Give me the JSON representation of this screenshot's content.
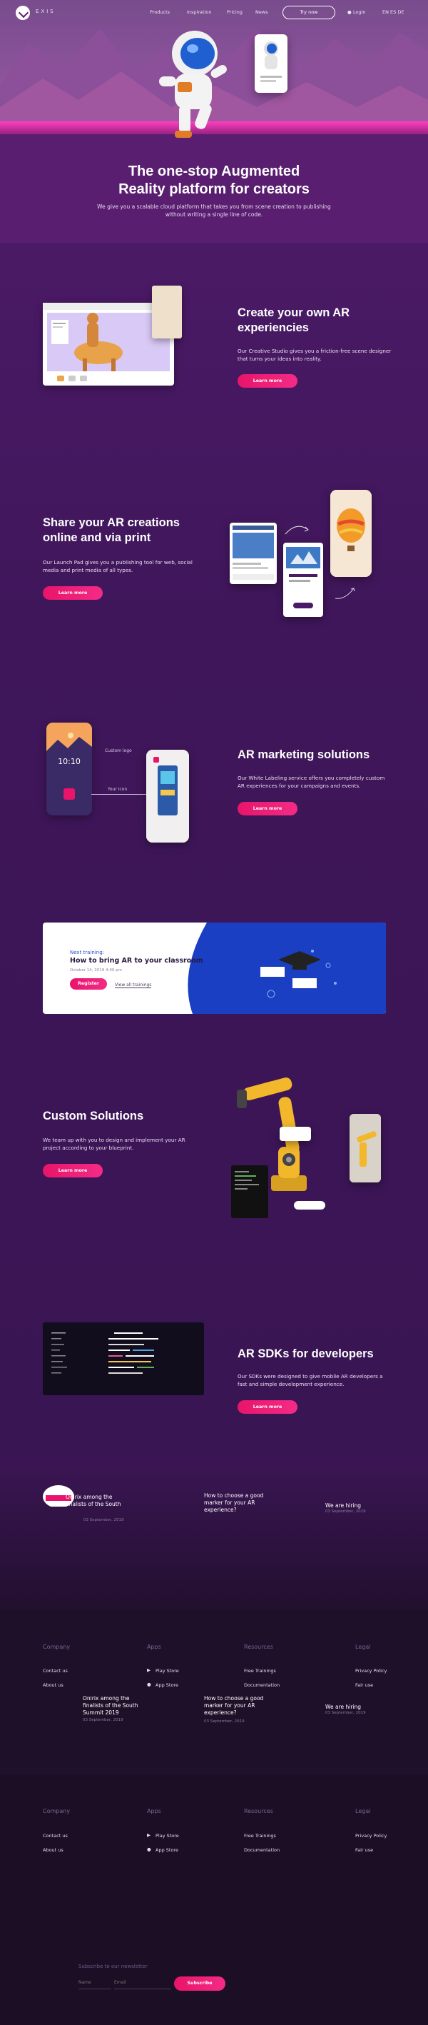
{
  "nav": {
    "logo_text": "EXIS",
    "links": [
      "Products",
      "Inspiration",
      "Pricing",
      "News"
    ],
    "try_now": "Try now",
    "login": "Login",
    "langs": "EN  ES  DE"
  },
  "hero": {
    "title_line1": "The one-stop Augmented",
    "title_line2": "Reality platform for creators",
    "subtitle_line1": "We give you a scalable cloud platform that takes you from scene creation to publishing",
    "subtitle_line2": "without writing a single line of code."
  },
  "s1": {
    "title_line1": "Create your own AR",
    "title_line2": "experiencies",
    "text_line1": "Our Creative Studio gives you a friction-free scene designer",
    "text_line2": "that turns your ideas into reality.",
    "button": "Learn more"
  },
  "s2": {
    "title_line1": "Share your AR creations",
    "title_line2": "online and via print",
    "text_line1": "Our Launch Pad gives you a publishing tool for web, social",
    "text_line2": "media and print media of all types.",
    "button": "Learn more"
  },
  "s3": {
    "title": "AR marketing solutions",
    "text_line1": "Our White Labeling service offers you completely custom",
    "text_line2": "AR experiences for your campaigns and events.",
    "button": "Learn more",
    "phone_time": "10:10",
    "label_logo": "Custom logo",
    "label_icon": "Your icon"
  },
  "training": {
    "kicker": "Next training:",
    "title": "How to bring AR to your classroom",
    "date": "October 14, 2019 4:00 pm",
    "register": "Register",
    "view_all": "View all trainings"
  },
  "s4": {
    "title": "Custom Solutions",
    "text_line1": "We team up with you to design and implement your AR",
    "text_line2": "project according to your blueprint.",
    "button": "Learn more"
  },
  "s5": {
    "title": "AR SDKs for developers",
    "text_line1": "Our SDKs were designed to give mobile AR developers a",
    "text_line2": "fast and simple development experience.",
    "button": "Learn more"
  },
  "news": [
    {
      "title_line1": "Onirix among the",
      "title_line2": "finalists of the South",
      "title_line3": "Summit 2019",
      "date": "03 September, 2019"
    },
    {
      "title_line1": "How to choose a good",
      "title_line2": "marker for your AR",
      "title_line3": "experience?",
      "date": "03 September, 2019"
    },
    {
      "title_line1": "We are hiring",
      "title_line2": "",
      "title_line3": "",
      "date": "03 September, 2019"
    }
  ],
  "footer": {
    "company": "Company",
    "apps": "Apps",
    "resources": "Resources",
    "legal": "Legal",
    "contact": "Contact us",
    "about": "About us",
    "play_store": "Play Store",
    "app_store": "App Store",
    "trainings": "Free Trainings",
    "docs": "Documentation",
    "privacy": "Privacy Policy",
    "fair": "Fair use"
  },
  "newsletter": {
    "label": "Subscribe to our newsletter",
    "name_placeholder": "Name",
    "email_placeholder": "Email",
    "button": "Subscribe"
  },
  "colors": {
    "accent": "#ee1f78",
    "bg": "#4b1a66",
    "footer": "#1d0f28"
  }
}
